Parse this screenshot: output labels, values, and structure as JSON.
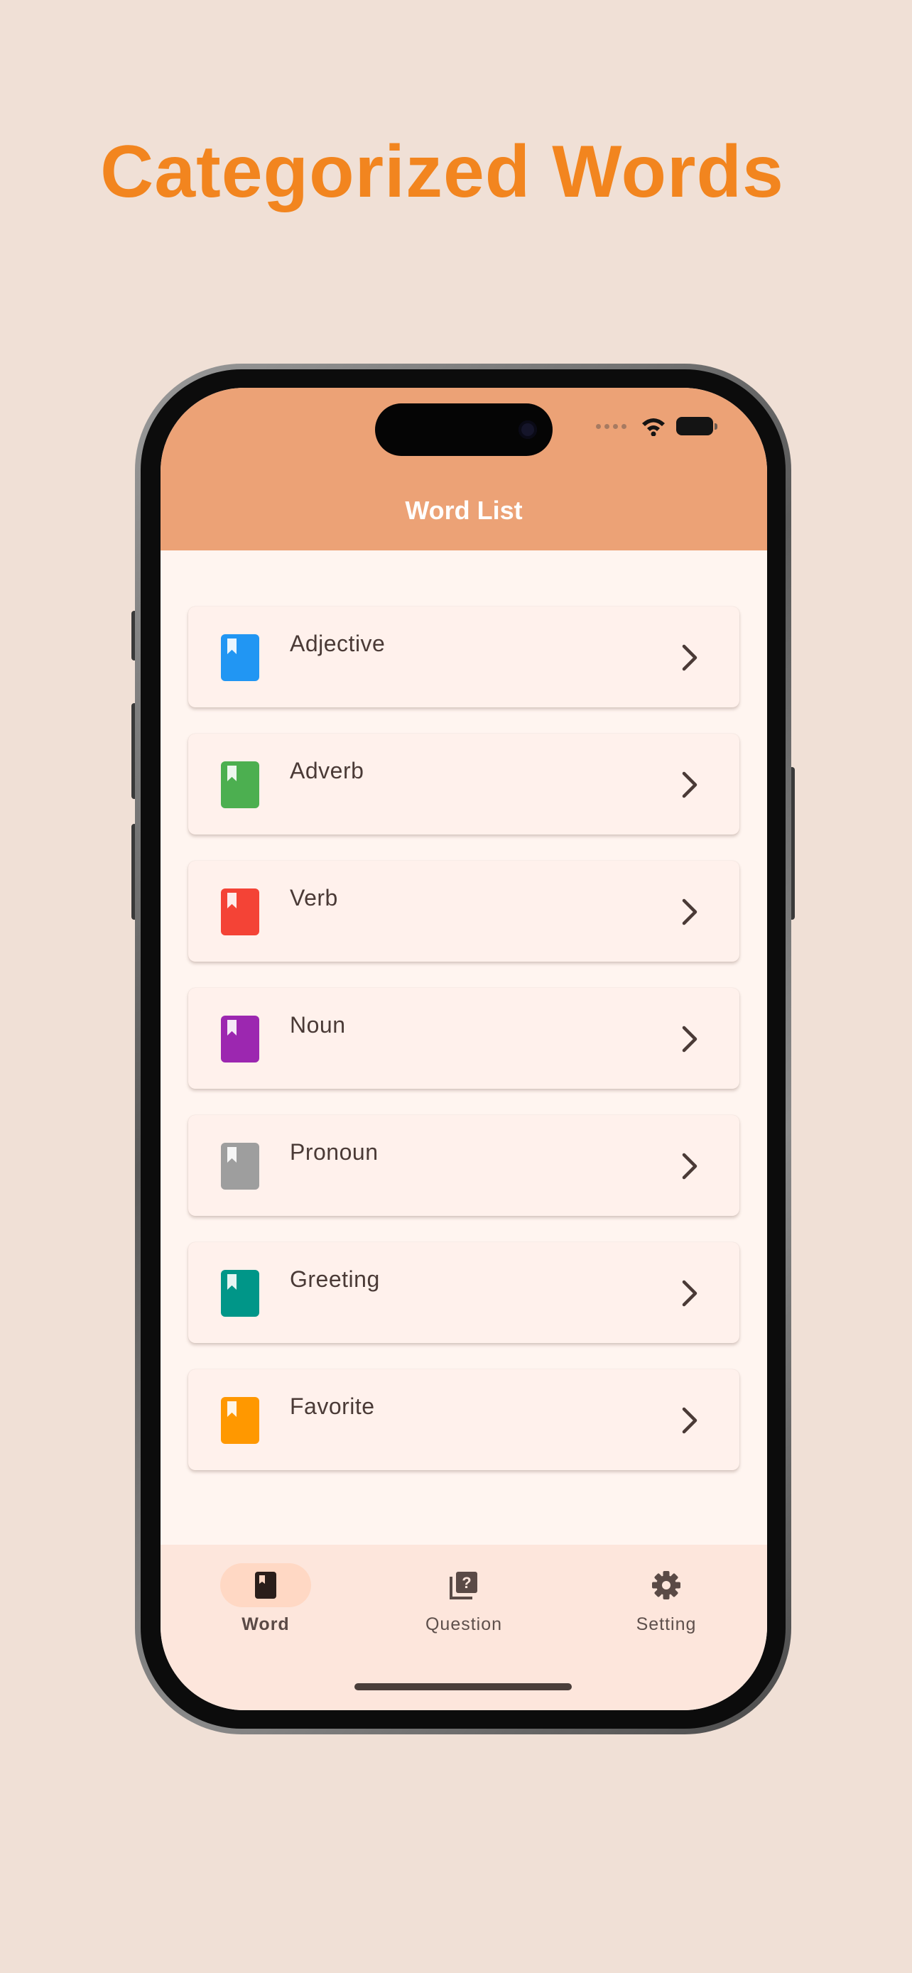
{
  "headline": "Categorized Words",
  "appbar": {
    "title": "Word List"
  },
  "categories": [
    {
      "label": "Adjective",
      "color": "#2196f3"
    },
    {
      "label": "Adverb",
      "color": "#4caf50"
    },
    {
      "label": "Verb",
      "color": "#f44336"
    },
    {
      "label": "Noun",
      "color": "#9c27b0"
    },
    {
      "label": "Pronoun",
      "color": "#9e9e9e"
    },
    {
      "label": "Greeting",
      "color": "#009688"
    },
    {
      "label": "Favorite",
      "color": "#ff9800"
    }
  ],
  "nav": {
    "items": [
      {
        "label": "Word",
        "icon": "book-icon",
        "active": true
      },
      {
        "label": "Question",
        "icon": "quiz-icon",
        "active": false
      },
      {
        "label": "Setting",
        "icon": "gear-icon",
        "active": false
      }
    ]
  },
  "colors": {
    "background": "#f0e0d6",
    "headline": "#f2851f",
    "appbar": "#eca276",
    "nav_bar": "#fde6dc",
    "active_pill": "#ffd8c4"
  }
}
